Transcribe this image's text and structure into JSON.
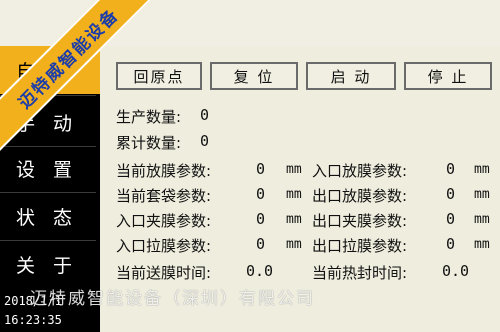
{
  "sidebar": {
    "items": [
      {
        "label": "自 动"
      },
      {
        "label": "手 动"
      },
      {
        "label": "设 置"
      },
      {
        "label": "状 态"
      },
      {
        "label": "关 于"
      }
    ],
    "date": "2018/1/1",
    "time": "16:23:35"
  },
  "buttons": {
    "home": "回原点",
    "reset": "复 位",
    "start": "启 动",
    "stop": "停 止"
  },
  "counts": {
    "production_label": "生产数量:",
    "production_value": "0",
    "cumulative_label": "累计数量:",
    "cumulative_value": "0"
  },
  "params": {
    "rows": [
      {
        "left_label": "当前放膜参数:",
        "left_value": "0",
        "right_label": "入口放膜参数:",
        "right_value": "0"
      },
      {
        "left_label": "当前套袋参数:",
        "left_value": "0",
        "right_label": "出口放膜参数:",
        "right_value": "0"
      },
      {
        "left_label": "入口夹膜参数:",
        "left_value": "0",
        "right_label": "出口夹膜参数:",
        "right_value": "0"
      },
      {
        "left_label": "入口拉膜参数:",
        "left_value": "0",
        "right_label": "出口拉膜参数:",
        "right_value": "0"
      }
    ],
    "unit": "mm"
  },
  "times": {
    "feed_label": "当前送膜时间:",
    "feed_value": "0.0",
    "seal_label": "当前热封时间:",
    "seal_value": "0.0"
  },
  "watermark": {
    "banner": "迈特威智能设备",
    "line": "迈特威智能设备（深圳）有限公司"
  }
}
